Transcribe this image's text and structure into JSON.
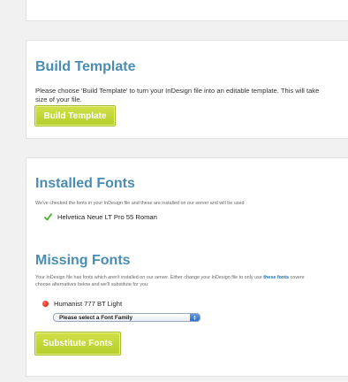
{
  "build": {
    "title": "Build Template",
    "description": "Please choose 'Build Template' to turn your InDesign file into an editable template. This will take",
    "description_tail": "size of your file.",
    "button_label": "Build Template"
  },
  "installed": {
    "title": "Installed Fonts",
    "description": "We've checked the fonts in your InDesign file and these are installed on our server and will be used",
    "fonts": [
      "Helvetica Neue LT Pro 55 Roman"
    ]
  },
  "missing": {
    "title": "Missing Fonts",
    "description_pre": "Your InDesign file has fonts which aren't installed on our server. Either change your InDesign file to only use",
    "link_text": "these fonts",
    "description_post": "covere",
    "description_line2": "choose alternatives below and we'll substitute for you:",
    "fonts": [
      {
        "name": "Humanist 777 BT Light",
        "select_value": "Please select a Font Family"
      }
    ],
    "button_label": "Substitute Fonts"
  },
  "colors": {
    "heading": "#4a8db2",
    "button": "#c3d739",
    "check": "#4caf2a",
    "missing_dot": "#d0210f"
  }
}
